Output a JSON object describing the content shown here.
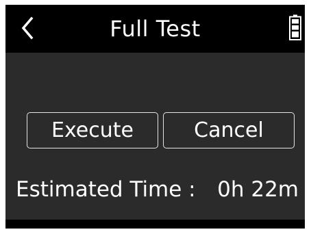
{
  "header": {
    "title": "Full Test",
    "back_icon": "chevron-left-icon",
    "battery_icon": "battery-full-icon"
  },
  "actions": {
    "execute_label": "Execute",
    "cancel_label": "Cancel"
  },
  "estimate": {
    "label": "Estimated Time :",
    "value": "0h 22m"
  },
  "colors": {
    "background": "#2b2b2b",
    "titlebar": "#000000",
    "text": "#ffffff",
    "button_border": "#e6e6e6"
  }
}
